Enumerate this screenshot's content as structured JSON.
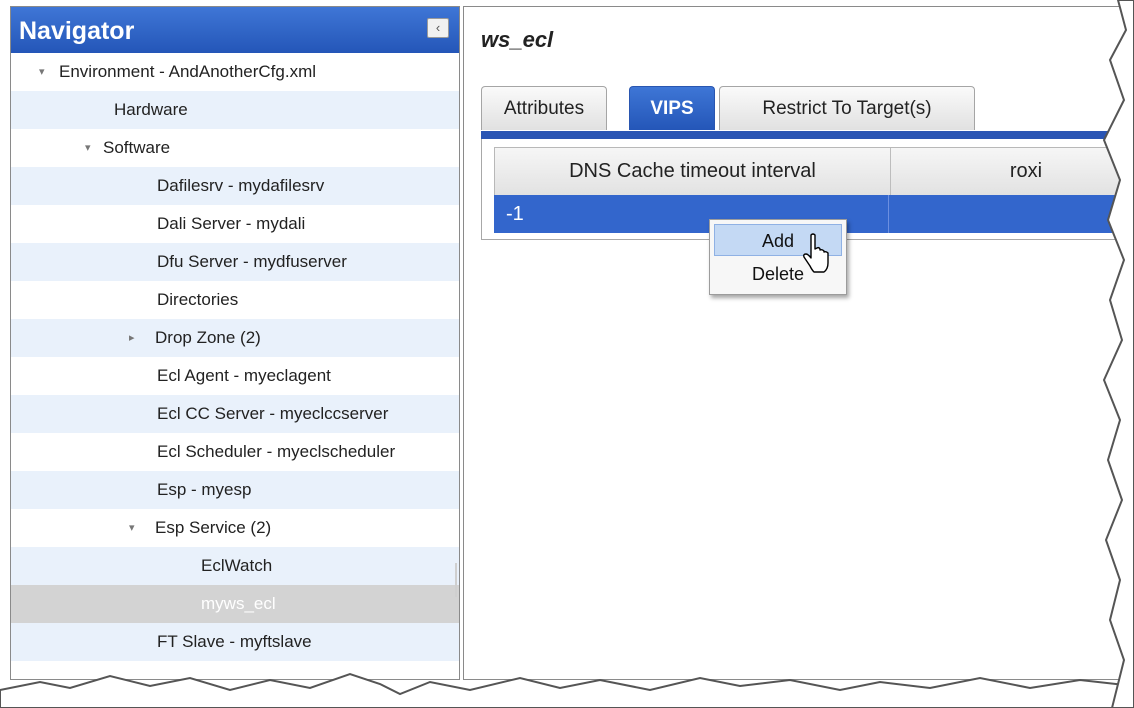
{
  "navigator": {
    "title": "Navigator",
    "collapse_icon": "chevron-left-icon",
    "items": [
      {
        "label": "Environment - AndAnotherCfg.xml",
        "level": 0,
        "expanded": true
      },
      {
        "label": "Hardware",
        "level": 1
      },
      {
        "label": "Software",
        "level": 1,
        "expanded": true
      },
      {
        "label": "Dafilesrv - mydafilesrv",
        "level": 2
      },
      {
        "label": "Dali Server - mydali",
        "level": 2
      },
      {
        "label": "Dfu Server - mydfuserver",
        "level": 2
      },
      {
        "label": "Directories",
        "level": 2
      },
      {
        "label": "Drop Zone (2)",
        "level": 2,
        "expanded": false
      },
      {
        "label": "Ecl Agent - myeclagent",
        "level": 2
      },
      {
        "label": "Ecl CC Server - myeclccserver",
        "level": 2
      },
      {
        "label": "Ecl Scheduler - myeclscheduler",
        "level": 2
      },
      {
        "label": "Esp - myesp",
        "level": 2
      },
      {
        "label": "Esp Service (2)",
        "level": 2,
        "expanded": true
      },
      {
        "label": "EclWatch",
        "level": 3
      },
      {
        "label": "myws_ecl",
        "level": 3,
        "selected": true
      },
      {
        "label": "FT Slave - myftslave",
        "level": 2
      }
    ]
  },
  "main": {
    "title": "ws_ecl",
    "tabs": [
      {
        "label": "Attributes",
        "active": false
      },
      {
        "label": "VIPS",
        "active": true
      },
      {
        "label": "Restrict To Target(s)",
        "active": false
      }
    ],
    "grid": {
      "columns": [
        "DNS Cache timeout interval",
        "roxi"
      ],
      "rows": [
        [
          "-1",
          ""
        ]
      ]
    }
  },
  "context_menu": {
    "items": [
      {
        "label": "Add",
        "hover": true
      },
      {
        "label": "Delete",
        "hover": false
      }
    ]
  },
  "colors": {
    "header_blue": "#2456b8",
    "selected_row": "#3366cc",
    "alt_row": "#e9f1fb",
    "selected_tree_item": "#d3d3d3"
  }
}
